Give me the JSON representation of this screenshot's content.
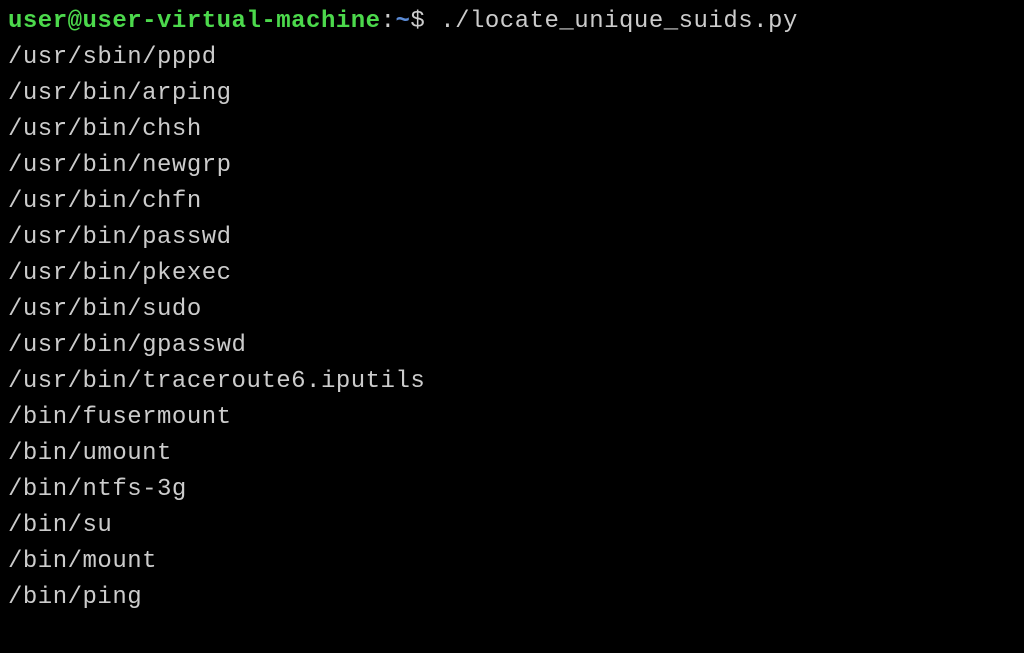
{
  "prompt": {
    "user_host": "user@user-virtual-machine",
    "colon": ":",
    "path": "~",
    "dollar": "$ ",
    "command": "./locate_unique_suids.py"
  },
  "output_lines": [
    "/usr/sbin/pppd",
    "/usr/bin/arping",
    "/usr/bin/chsh",
    "/usr/bin/newgrp",
    "/usr/bin/chfn",
    "/usr/bin/passwd",
    "/usr/bin/pkexec",
    "/usr/bin/sudo",
    "/usr/bin/gpasswd",
    "/usr/bin/traceroute6.iputils",
    "/bin/fusermount",
    "/bin/umount",
    "/bin/ntfs-3g",
    "/bin/su",
    "/bin/mount",
    "/bin/ping"
  ]
}
